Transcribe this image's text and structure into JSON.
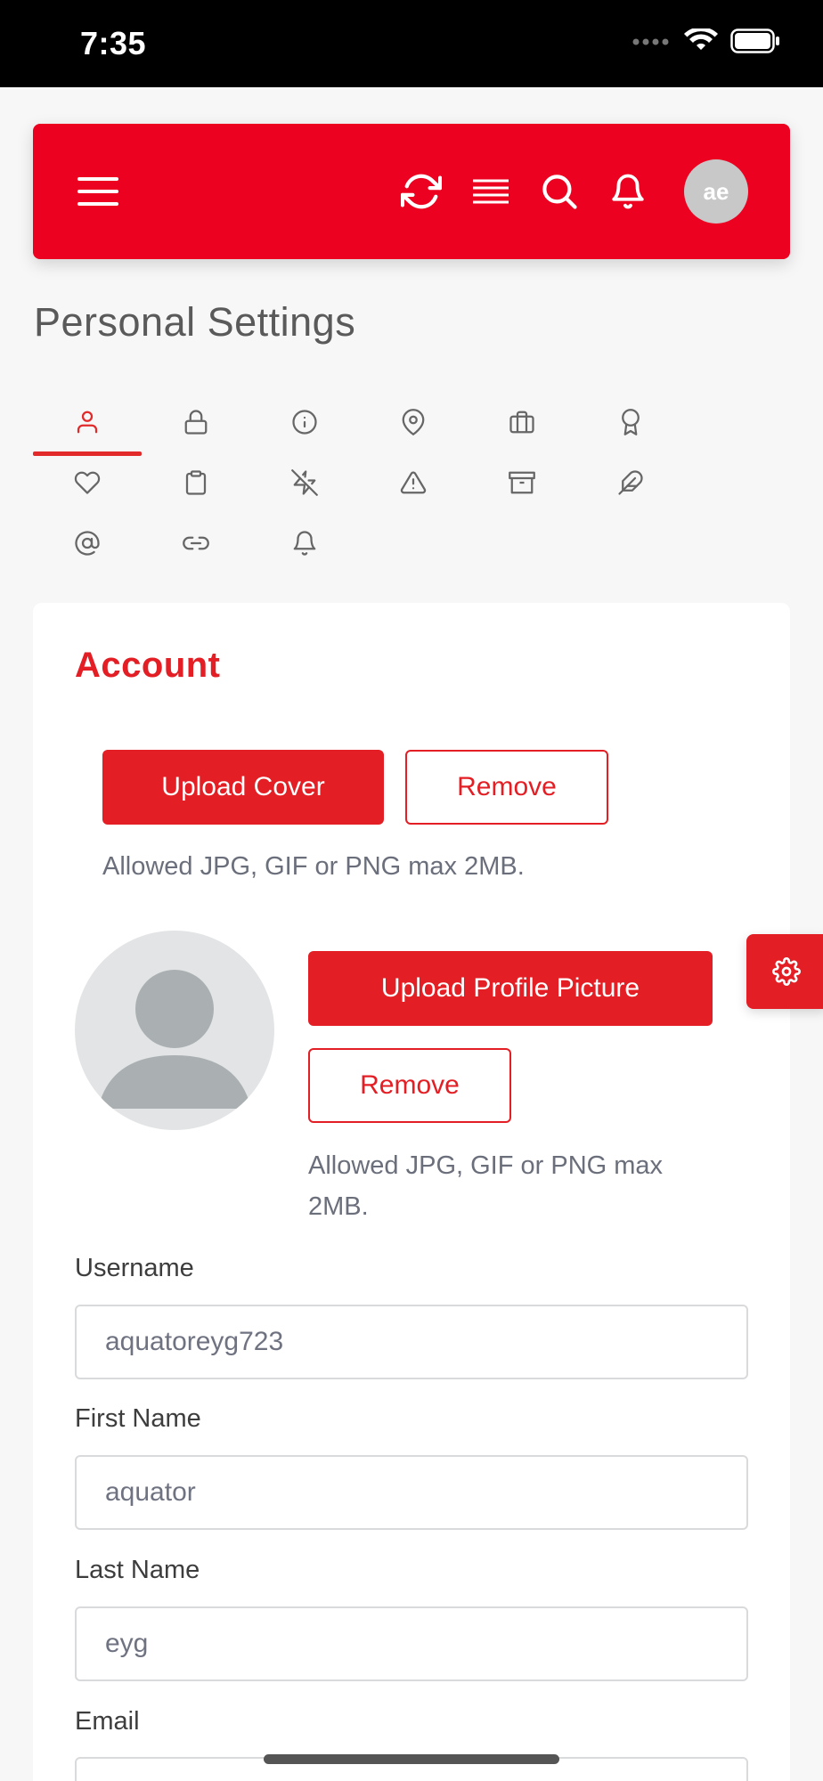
{
  "status_bar": {
    "time": "7:35"
  },
  "header": {
    "avatar_initials": "ae"
  },
  "page": {
    "title": "Personal Settings"
  },
  "tabs": [
    {
      "icon": "user-icon",
      "active": true
    },
    {
      "icon": "lock-icon"
    },
    {
      "icon": "info-icon"
    },
    {
      "icon": "map-pin-icon"
    },
    {
      "icon": "briefcase-icon"
    },
    {
      "icon": "award-icon"
    },
    {
      "icon": "heart-icon"
    },
    {
      "icon": "clipboard-icon"
    },
    {
      "icon": "zap-off-icon"
    },
    {
      "icon": "alert-triangle-icon"
    },
    {
      "icon": "archive-icon"
    },
    {
      "icon": "feather-icon"
    },
    {
      "icon": "at-sign-icon"
    },
    {
      "icon": "link-icon"
    },
    {
      "icon": "bell-icon"
    }
  ],
  "account": {
    "title": "Account",
    "upload_cover_label": "Upload Cover",
    "remove_cover_label": "Remove",
    "cover_hint": "Allowed JPG, GIF or PNG max 2MB.",
    "upload_profile_label": "Upload Profile Picture",
    "remove_profile_label": "Remove",
    "profile_hint_line1": "Allowed JPG, GIF or PNG max",
    "profile_hint_line2": "2MB."
  },
  "form": {
    "username_label": "Username",
    "username_value": "aquatoreyg723",
    "first_name_label": "First Name",
    "first_name_value": "aquator",
    "last_name_label": "Last Name",
    "last_name_value": "eyg",
    "email_label": "Email"
  },
  "colors": {
    "brand": "#ec0120",
    "accent": "#e31e24"
  }
}
